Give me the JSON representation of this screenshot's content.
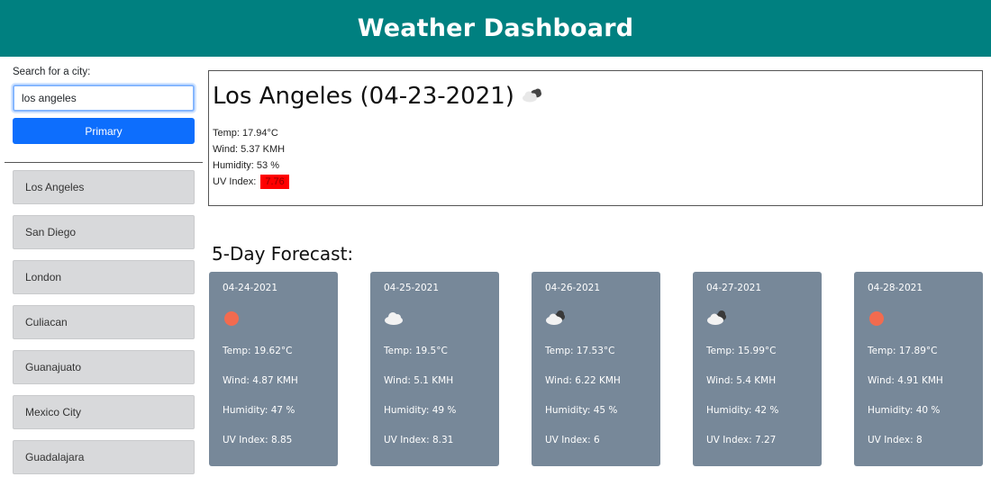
{
  "header": {
    "title": "Weather Dashboard"
  },
  "search": {
    "label": "Search for a city:",
    "value": "los angeles",
    "button_label": "Primary"
  },
  "history": [
    "Los Angeles",
    "San Diego",
    "London",
    "Culiacan",
    "Guanajuato",
    "Mexico City",
    "Guadalajara"
  ],
  "current": {
    "title": "Los Angeles (04-23-2021)",
    "icon": "broken-clouds-icon",
    "temp": "Temp: 17.94°C",
    "wind": "Wind: 5.37 KMH",
    "humidity": "Humidity: 53 %",
    "uv_label": "UV Index:",
    "uv_value": "7.76",
    "uv_color": "#ff0000"
  },
  "forecast": {
    "title": "5-Day Forecast:",
    "card_color": "#778899",
    "days": [
      {
        "date": "04-24-2021",
        "icon": "sun-icon",
        "temp": "Temp: 19.62°C",
        "wind": "Wind: 4.87 KMH",
        "humidity": "Humidity: 47 %",
        "uv": "UV Index: 8.85"
      },
      {
        "date": "04-25-2021",
        "icon": "cloud-icon",
        "temp": "Temp: 19.5°C",
        "wind": "Wind: 5.1 KMH",
        "humidity": "Humidity: 49 %",
        "uv": "UV Index: 8.31"
      },
      {
        "date": "04-26-2021",
        "icon": "broken-clouds-icon",
        "temp": "Temp: 17.53°C",
        "wind": "Wind: 6.22 KMH",
        "humidity": "Humidity: 45 %",
        "uv": "UV Index: 6"
      },
      {
        "date": "04-27-2021",
        "icon": "broken-clouds-icon",
        "temp": "Temp: 15.99°C",
        "wind": "Wind: 5.4 KMH",
        "humidity": "Humidity: 42 %",
        "uv": "UV Index: 7.27"
      },
      {
        "date": "04-28-2021",
        "icon": "sun-icon",
        "temp": "Temp: 17.89°C",
        "wind": "Wind: 4.91 KMH",
        "humidity": "Humidity: 40 %",
        "uv": "UV Index: 8"
      }
    ]
  }
}
